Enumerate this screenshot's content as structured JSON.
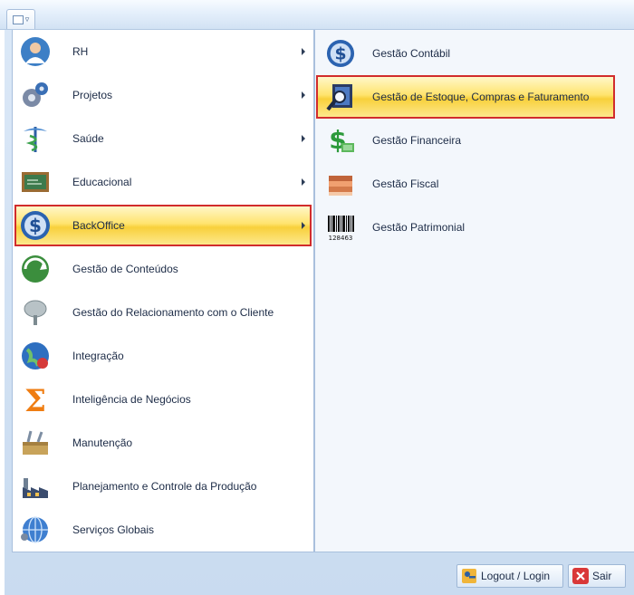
{
  "menu": {
    "items": [
      {
        "label": "RH",
        "icon": "people-icon",
        "has_submenu": true
      },
      {
        "label": "Projetos",
        "icon": "gears-icon",
        "has_submenu": true
      },
      {
        "label": "Saúde",
        "icon": "caduceus-icon",
        "has_submenu": true
      },
      {
        "label": "Educacional",
        "icon": "chalkboard-icon",
        "has_submenu": true
      },
      {
        "label": "BackOffice",
        "icon": "dollar-icon",
        "has_submenu": true,
        "selected": true
      },
      {
        "label": "Gestão de Conteúdos",
        "icon": "globe-arrow-icon",
        "has_submenu": false
      },
      {
        "label": "Gestão do Relacionamento com o Cliente",
        "icon": "tree-icon",
        "has_submenu": false
      },
      {
        "label": "Integração",
        "icon": "globe-icon",
        "has_submenu": false
      },
      {
        "label": "Inteligência de Negócios",
        "icon": "sigma-icon",
        "has_submenu": false
      },
      {
        "label": "Manutenção",
        "icon": "toolbox-icon",
        "has_submenu": false
      },
      {
        "label": "Planejamento e Controle da Produção",
        "icon": "factory-icon",
        "has_submenu": false
      },
      {
        "label": "Serviços Globais",
        "icon": "globe-network-icon",
        "has_submenu": false
      }
    ]
  },
  "submenu": {
    "items": [
      {
        "label": "Gestão Contábil",
        "icon": "dollar-icon"
      },
      {
        "label": "Gestão de Estoque, Compras e Faturamento",
        "icon": "magnifier-icon",
        "selected": true
      },
      {
        "label": "Gestão Financeira",
        "icon": "money-icon"
      },
      {
        "label": "Gestão Fiscal",
        "icon": "stack-icon"
      },
      {
        "label": "Gestão Patrimonial",
        "icon": "barcode-icon",
        "barcode_text": "128463"
      }
    ]
  },
  "footer": {
    "logout_label": "Logout / Login",
    "exit_label": "Sair"
  },
  "colors": {
    "highlight_border": "#d12c2c",
    "highlight_fill": "#ffe46e",
    "panel_border": "#a9c0dd"
  }
}
